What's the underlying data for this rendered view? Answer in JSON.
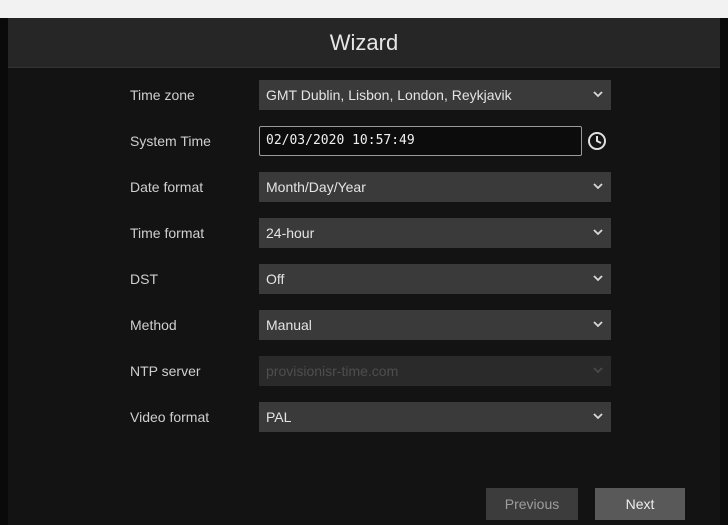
{
  "window": {
    "title": "Wizard"
  },
  "fields": [
    {
      "label": "Time zone",
      "value": "GMT Dublin, Lisbon, London, Reykjavik"
    },
    {
      "label": "System Time",
      "value": "02/03/2020 10:57:49"
    },
    {
      "label": "Date format",
      "value": "Month/Day/Year"
    },
    {
      "label": "Time format",
      "value": "24-hour"
    },
    {
      "label": "DST",
      "value": "Off"
    },
    {
      "label": "Method",
      "value": "Manual"
    },
    {
      "label": "NTP server",
      "value": "provisionisr-time.com",
      "disabled": true
    },
    {
      "label": "Video format",
      "value": "PAL"
    }
  ],
  "buttons": {
    "previous": "Previous",
    "next": "Next"
  },
  "icons": {
    "dropdown": "chevron-down-icon",
    "clock": "clock-icon"
  },
  "colors": {
    "background": "#131313",
    "field": "#3a3a3a",
    "title_bar": "#262626"
  }
}
